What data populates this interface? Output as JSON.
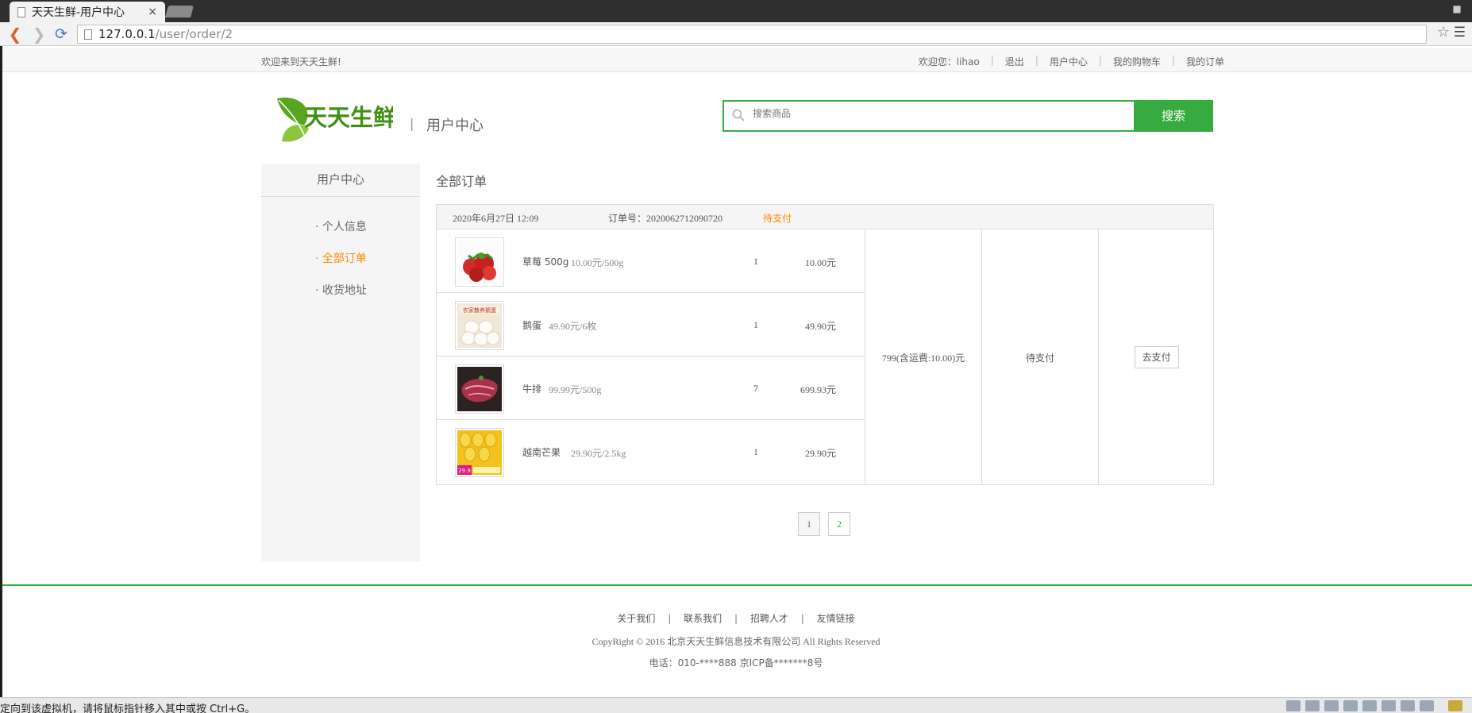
{
  "browser": {
    "tab_title": "天天生鲜-用户中心",
    "tab_close": "×",
    "url_host": "127.0.0.1",
    "url_path": "/user/order/2"
  },
  "topbar": {
    "welcome": "欢迎来到天天生鲜!",
    "user_greeting": "欢迎您：lihao",
    "logout": "退出",
    "user_center": "用户中心",
    "cart": "我的购物车",
    "my_orders": "我的订单",
    "separator": "|"
  },
  "header": {
    "logo_text": "天天生鲜",
    "separator": "|",
    "subtitle": "用户中心",
    "search_placeholder": "搜索商品",
    "search_button": "搜索"
  },
  "sidebar": {
    "title": "用户中心",
    "items": [
      {
        "label": "· 个人信息",
        "active": false
      },
      {
        "label": "· 全部订单",
        "active": true
      },
      {
        "label": "· 收货地址",
        "active": false
      }
    ]
  },
  "main": {
    "title": "全部订单",
    "order": {
      "date": "2020年6月27日 12:09",
      "number": "订单号：2020062712090720",
      "status_head": "待支付",
      "goods": [
        {
          "name": "草莓 500g",
          "price": "10.00元/500g",
          "count": "1",
          "total": "10.00元",
          "image": "strawberry"
        },
        {
          "name": "鹅蛋",
          "price": "49.90元/6枚",
          "count": "1",
          "total": "49.90元",
          "image": "goose-eggs"
        },
        {
          "name": "牛排",
          "price": "99.99元/500g",
          "count": "7",
          "total": "699.93元",
          "image": "steak"
        },
        {
          "name": "越南芒果",
          "price": "29.90元/2.5kg",
          "count": "1",
          "total": "29.90元",
          "image": "mango"
        }
      ],
      "sum": "799(含运费:10.00)元",
      "status": "待支付",
      "action": "去支付"
    },
    "pages": [
      "1",
      "2"
    ],
    "current_page": "2"
  },
  "footer": {
    "links": [
      "关于我们",
      "联系我们",
      "招聘人才",
      "友情链接"
    ],
    "separator": "|",
    "copyright": "CopyRight © 2016 北京天天生鲜信息技术有限公司 All Rights Reserved",
    "phone": "电话：010-****888 京ICP备*******8号"
  },
  "vm_status": {
    "message": "定向到该虚拟机，请将鼠标指针移入其中或按 Ctrl+G。"
  },
  "colors": {
    "brand_green": "#37ab40",
    "accent_orange": "#ff8800"
  }
}
